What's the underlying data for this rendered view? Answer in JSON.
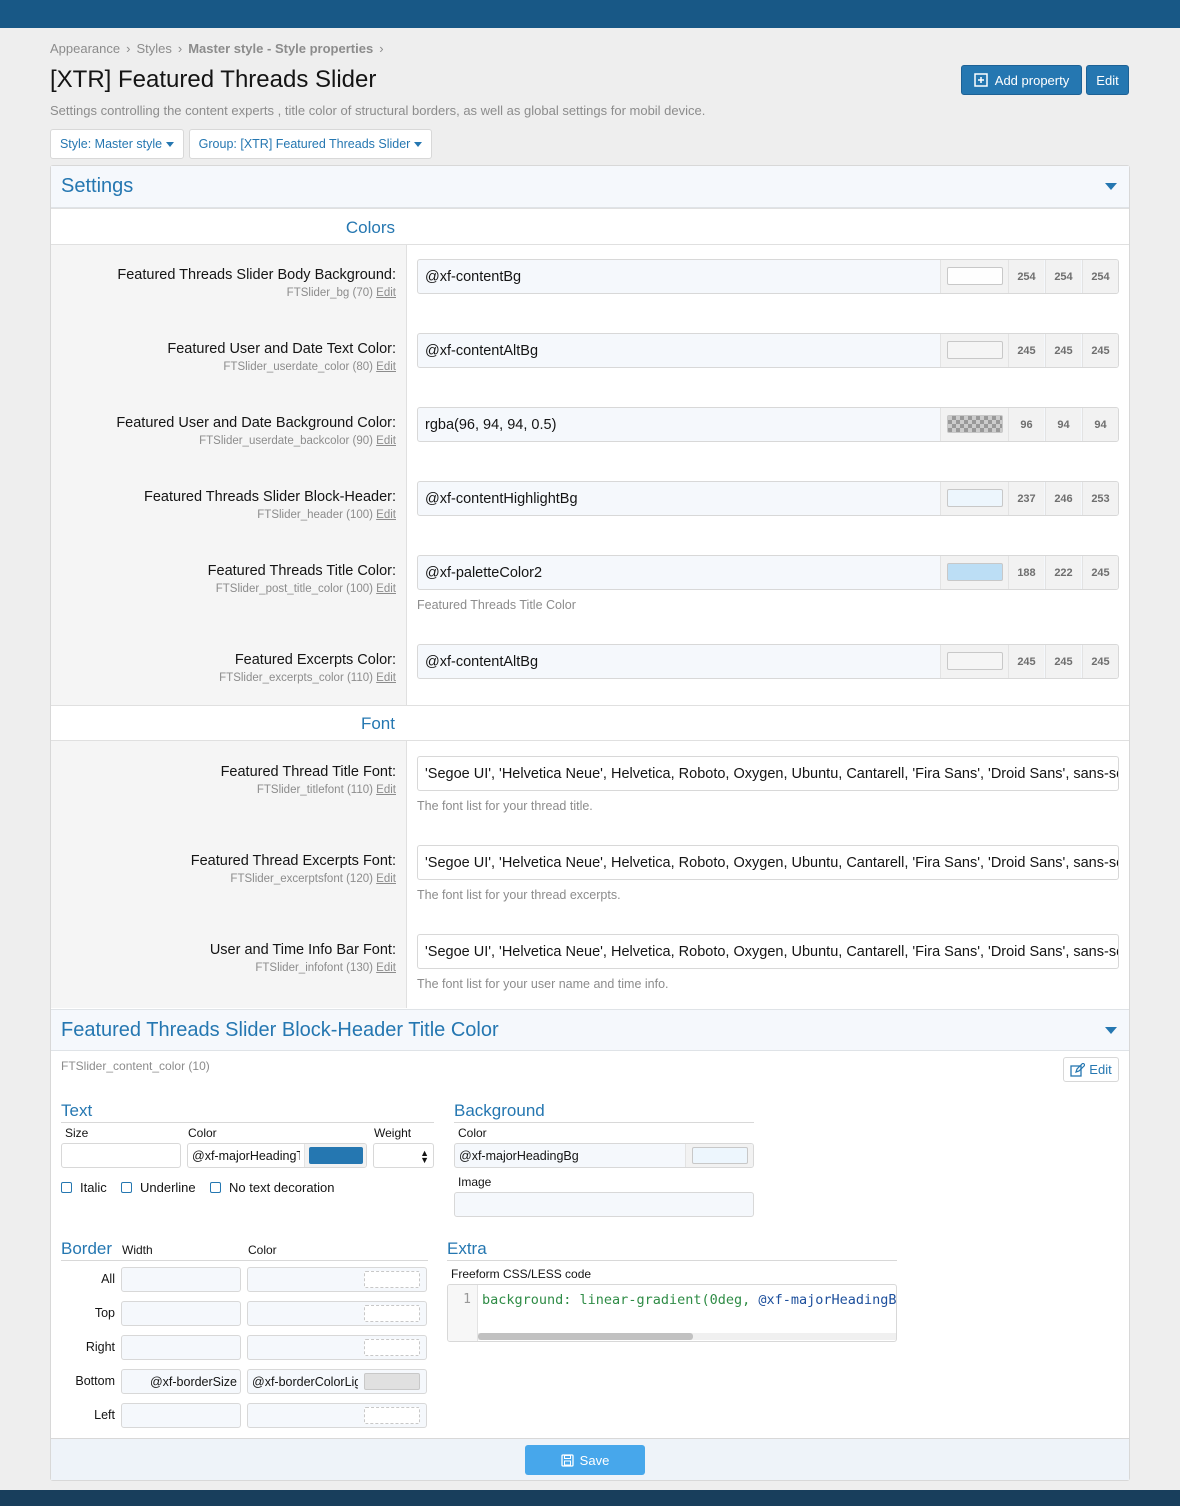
{
  "breadcrumbs": [
    "Appearance",
    "Styles",
    "Master style",
    "Style properties"
  ],
  "page": {
    "title": "[XTR] Featured Threads Slider",
    "description": "Settings controlling the content experts , title color of structural borders, as well as global settings for mobil device.",
    "add_property_label": "Add property",
    "edit_label": "Edit"
  },
  "filters": {
    "style": "Style: Master style",
    "group": "Group: [XTR] Featured Threads Slider"
  },
  "settings": {
    "title": "Settings",
    "colors_heading": "Colors",
    "font_heading": "Font",
    "edit_link": "Edit",
    "colors": [
      {
        "label": "Featured Threads Slider Body Background:",
        "sub": "FTSlider_bg (70)",
        "value": "@xf-contentBg",
        "rgb": [
          "254",
          "254",
          "254"
        ],
        "swatch": "#fefefe",
        "hint": ""
      },
      {
        "label": "Featured User and Date Text Color:",
        "sub": "FTSlider_userdate_color (80)",
        "value": "@xf-contentAltBg",
        "rgb": [
          "245",
          "245",
          "245"
        ],
        "swatch": "#f5f5f5",
        "hint": ""
      },
      {
        "label": "Featured User and Date Background Color:",
        "sub": "FTSlider_userdate_backcolor (90)",
        "value": "rgba(96, 94, 94, 0.5)",
        "rgb": [
          "96",
          "94",
          "94"
        ],
        "swatch": "checker",
        "hint": ""
      },
      {
        "label": "Featured Threads Slider Block-Header:",
        "sub": "FTSlider_header (100)",
        "value": "@xf-contentHighlightBg",
        "rgb": [
          "237",
          "246",
          "253"
        ],
        "swatch": "#edf6fd",
        "hint": ""
      },
      {
        "label": "Featured Threads Title Color:",
        "sub": "FTSlider_post_title_color (100)",
        "value": "@xf-paletteColor2",
        "rgb": [
          "188",
          "222",
          "245"
        ],
        "swatch": "#bcdef5",
        "hint": "Featured Threads Title Color"
      },
      {
        "label": "Featured Excerpts Color:",
        "sub": "FTSlider_excerpts_color (110)",
        "value": "@xf-contentAltBg",
        "rgb": [
          "245",
          "245",
          "245"
        ],
        "swatch": "#f5f5f5",
        "hint": ""
      }
    ],
    "fonts": [
      {
        "label": "Featured Thread Title Font:",
        "sub": "FTSlider_titlefont (110)",
        "value": "'Segoe UI', 'Helvetica Neue', Helvetica, Roboto, Oxygen, Ubuntu, Cantarell, 'Fira Sans', 'Droid Sans', sans-serif",
        "hint": "The font list for your thread title."
      },
      {
        "label": "Featured Thread Excerpts Font:",
        "sub": "FTSlider_excerptsfont (120)",
        "value": "'Segoe UI', 'Helvetica Neue', Helvetica, Roboto, Oxygen, Ubuntu, Cantarell, 'Fira Sans', 'Droid Sans', sans-serif",
        "hint": "The font list for your thread excerpts."
      },
      {
        "label": "User and Time Info Bar Font:",
        "sub": "FTSlider_infofont (130)",
        "value": "'Segoe UI', 'Helvetica Neue', Helvetica, Roboto, Oxygen, Ubuntu, Cantarell, 'Fira Sans', 'Droid Sans', sans-serif",
        "hint": "The font list for your user name and time info."
      }
    ]
  },
  "block_header": {
    "title": "Featured Threads Slider Block-Header Title Color",
    "property_id": "FTSlider_content_color (10)",
    "edit_label": "Edit",
    "text": {
      "heading": "Text",
      "size_label": "Size",
      "size_value": "",
      "color_label": "Color",
      "color_value": "@xf-majorHeadingText",
      "color_swatch": "#2577b1",
      "weight_label": "Weight",
      "italic": "Italic",
      "underline": "Underline",
      "no_decoration": "No text decoration"
    },
    "background": {
      "heading": "Background",
      "color_label": "Color",
      "color_value": "@xf-majorHeadingBg",
      "color_swatch": "#edf6fd",
      "image_label": "Image"
    },
    "border": {
      "heading": "Border",
      "width_label": "Width",
      "color_label": "Color",
      "rows": [
        {
          "label": "All",
          "width": "",
          "color": ""
        },
        {
          "label": "Top",
          "width": "",
          "color": ""
        },
        {
          "label": "Right",
          "width": "",
          "color": ""
        },
        {
          "label": "Bottom",
          "width": "@xf-borderSize",
          "color": "@xf-borderColorLight"
        },
        {
          "label": "Left",
          "width": "",
          "color": ""
        }
      ]
    },
    "extra": {
      "heading": "Extra",
      "code_label": "Freeform CSS/LESS code",
      "line_number": "1",
      "code_prop": "background:",
      "code_func": "linear-gradient(0deg,",
      "code_var": "@xf-majorHeadingBg"
    },
    "save_label": "Save"
  }
}
